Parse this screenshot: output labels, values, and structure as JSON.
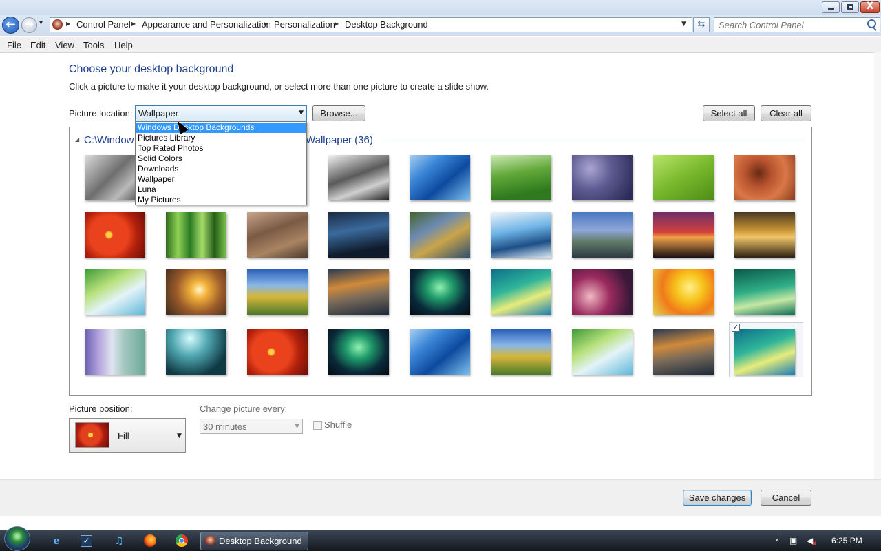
{
  "window": {
    "minimize_glyph": "",
    "maximize_glyph": "",
    "close_glyph": "X"
  },
  "nav": {
    "back_glyph": "←",
    "forward_glyph": "→",
    "recent_glyph": "▾"
  },
  "breadcrumb": [
    "Control Panel",
    "Appearance and Personalization",
    "Personalization",
    "Desktop Background"
  ],
  "search": {
    "placeholder": "Search Control Panel"
  },
  "menu": [
    "File",
    "Edit",
    "View",
    "Tools",
    "Help"
  ],
  "page": {
    "heading": "Choose your desktop background",
    "subtext": "Click a picture to make it your desktop background, or select more than one picture to create a slide show.",
    "location_label": "Picture location:",
    "location_value": "Wallpaper",
    "browse_label": "Browse...",
    "select_all_label": "Select all",
    "clear_all_label": "Clear all"
  },
  "gallery": {
    "group_title_left": "C:\\Window",
    "group_title_right": "Wallpaper (36)",
    "check_glyph": "✓",
    "thumbnails": [
      "linear-gradient(135deg,#dcdcdc,#6e6e6e 45%,#b9b9b9 70%,#3a3a3a)",
      "linear-gradient(160deg,#f2f2f2,#5a5a5a 45%,#cfcfcf 70%,#222)",
      "linear-gradient(140deg,#a8d0f2,#3b86d6 30%,#0d4a9e 60%,#7fc0ef)",
      "linear-gradient(170deg,#cfe9b5,#62a93a 40%,#2f7a1e 80%)",
      "radial-gradient(circle at 30% 30%,#a9a6d2,#5f5b93 40%,#2d2b55 90%)",
      "linear-gradient(150deg,#b9e36a,#78b82c 50%,#4e8c15)",
      "radial-gradient(circle at 40% 40%,#6a2a14,#b8542f 30%,#d97847 60%,#8a3b1e)",
      "radial-gradient(circle at 40% 50%,#ffcf40 0 6%,#e9421c 10% 45%,#b3210d 65%,#6b0f06)",
      "linear-gradient(90deg,#2d6c1c,#8fd155 20%,#2a7a24 40%,#a6dc6a 60%,#245e18 80%,#7cc34b)",
      "linear-gradient(160deg,#c8a58a,#7b5a44 40%,#a98462 70%,#4d3a2c)",
      "linear-gradient(170deg,#1a2a44,#3a6a9c 40%,#0f1a2a 80%)",
      "linear-gradient(150deg,#46622e,#6c8bb2 35%,#caa44a 60%,#2e4f6e)",
      "linear-gradient(170deg,#eef4fa,#6fb4e6 40%,#1d4f86 70%,#d8e8f5)",
      "linear-gradient(180deg,#4a78c0,#8fa6d8 40%,#5f7a66 65%,#2e3a44)",
      "linear-gradient(180deg,#6e2f6a,#d5413b 45%,#f0a347 55%,#1a0f16)",
      "linear-gradient(180deg,#4a3a22,#c99435 40%,#f0c66a 55%,#2d2112)",
      "linear-gradient(150deg,#3f9a3a,#b6e07a 35%,#e4f3f8 60%,#5fb8d8)",
      "radial-gradient(circle at 55% 45%,#fff6c8,#f2b23a 20%,#9a5a2a 55%,#3a2a1c)",
      "linear-gradient(180deg,#2a5fb8,#87b6e8 35%,#d6b63a 60%,#4b7a2a)",
      "linear-gradient(170deg,#2a3a55,#cf8a3a 35%,#7a6a5a 60%,#1c2a3a)",
      "radial-gradient(ellipse at 50% 40%,#8ff0b0,#1f9a6a 30%,#0a2a3a 65%,#040b14)",
      "linear-gradient(160deg,#0d6f8a,#2fb59a 40%,#e7ec7a 65%,#1a7fb4)",
      "radial-gradient(circle at 30% 60%,#f1b7c2,#9a2a5e 40%,#3a1838 80%)",
      "radial-gradient(circle at 60% 40%,#fff08a,#f7c31a 30%,#f07a1a 60%,#e3d24a)",
      "linear-gradient(170deg,#0a5a4a,#2fae86 45%,#c5e8a3 70%,#0f6f5a)",
      "linear-gradient(90deg,#6a5fb0,#b8a8df 25%,#dfe4f0 45%,#a4c8c0 65%,#6aa898)",
      "radial-gradient(circle at 40% 20%,#d6fbff,#4fa6b0 35%,#0f3a44 75%)",
      "radial-gradient(circle at 40% 50%,#ffcf40 0 6%,#e9421c 10% 45%,#b3210d 65%,#6b0f06)",
      "radial-gradient(ellipse at 50% 40%,#8ff0b0,#1f9a6a 30%,#0a2a3a 65%,#040b14)",
      "linear-gradient(140deg,#a8d0f2,#3b86d6 30%,#0d4a9e 60%,#7fc0ef)",
      "linear-gradient(180deg,#2a5fb8,#87b6e8 35%,#d6b63a 60%,#4b7a2a)",
      "linear-gradient(150deg,#3f9a3a,#b6e07a 35%,#e4f3f8 60%,#5fb8d8)",
      "linear-gradient(170deg,#2a3a55,#cf8a3a 35%,#7a6a5a 60%,#1c2a3a)",
      "linear-gradient(160deg,#0d6f8a,#2fb59a 40%,#e7ec7a 65%,#1a7fb4)"
    ]
  },
  "dropdown_options": [
    "Windows Desktop Backgrounds",
    "Pictures Library",
    "Top Rated Photos",
    "Solid Colors",
    "Downloads",
    "Wallpaper",
    "Luna",
    "My Pictures"
  ],
  "position": {
    "label": "Picture position:",
    "value": "Fill"
  },
  "interval": {
    "label": "Change picture every:",
    "value": "30 minutes"
  },
  "shuffle": {
    "label": "Shuffle"
  },
  "footer": {
    "save_label": "Save changes",
    "cancel_label": "Cancel"
  },
  "taskbar": {
    "ie_glyph": "e",
    "tasks_glyph": "✓",
    "music_glyph": "♫",
    "active_task": "Desktop Background",
    "tray_chevron": "‹",
    "network_glyph": "▣",
    "volume_glyph": "◀",
    "volume_x": "x",
    "clock": "6:25 PM"
  },
  "colors": {
    "accent": "#1e3f8c",
    "highlight": "#3399ff",
    "taskbar": "#1d2229"
  }
}
